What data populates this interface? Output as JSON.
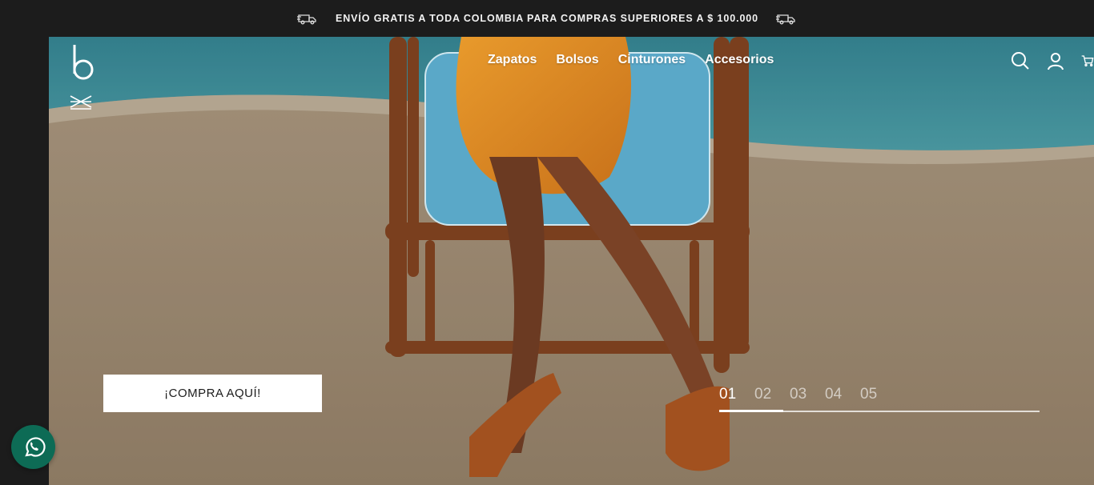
{
  "announcement": {
    "text": "ENVÍO GRATIS A TODA COLOMBIA PARA COMPRAS SUPERIORES A $ 100.000",
    "left_icon": "truck-icon",
    "right_icon": "truck-icon"
  },
  "header": {
    "logo_icon": "brand-logo-b",
    "menu_icon": "menu-toggle-icon",
    "nav": [
      {
        "label": "Zapatos"
      },
      {
        "label": "Bolsos"
      },
      {
        "label": "Cinturones"
      },
      {
        "label": "Accesorios"
      }
    ],
    "actions": [
      "search-icon",
      "account-icon",
      "cart-icon"
    ]
  },
  "hero": {
    "image": "woman-seated-rattan-chair-by-pool-wearing-sandals",
    "cta_label": "¡COMPRA AQUÍ!",
    "slides": [
      "01",
      "02",
      "03",
      "04",
      "05"
    ],
    "active_slide": 1,
    "progress_fraction": 0.2
  },
  "whatsapp": {
    "icon": "whatsapp-icon"
  },
  "colors": {
    "bar_background": "#1c1c1c",
    "whatsapp_green": "#0d6b55",
    "pool_blue": "#3f9aa6",
    "sand": "#b9a78f",
    "dress_orange": "#e08a22",
    "cushion_blue": "#5aa8c8",
    "rattan_brown": "#7a3f1e"
  }
}
